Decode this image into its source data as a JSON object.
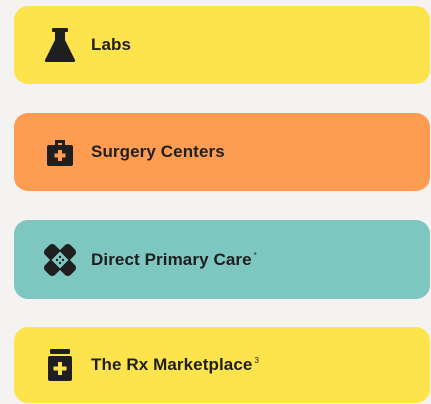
{
  "services": [
    {
      "label": "Labs",
      "sup": "",
      "icon": "flask-icon",
      "color": "#fde34c"
    },
    {
      "label": "Surgery Centers",
      "sup": "",
      "icon": "medical-kit-icon",
      "color": "#fe9d52"
    },
    {
      "label": "Direct Primary Care",
      "sup": "*",
      "icon": "bandage-icon",
      "color": "#7ec6c0"
    },
    {
      "label": "The Rx Marketplace",
      "sup": "3",
      "icon": "pill-bottle-icon",
      "color": "#fde34c"
    }
  ]
}
